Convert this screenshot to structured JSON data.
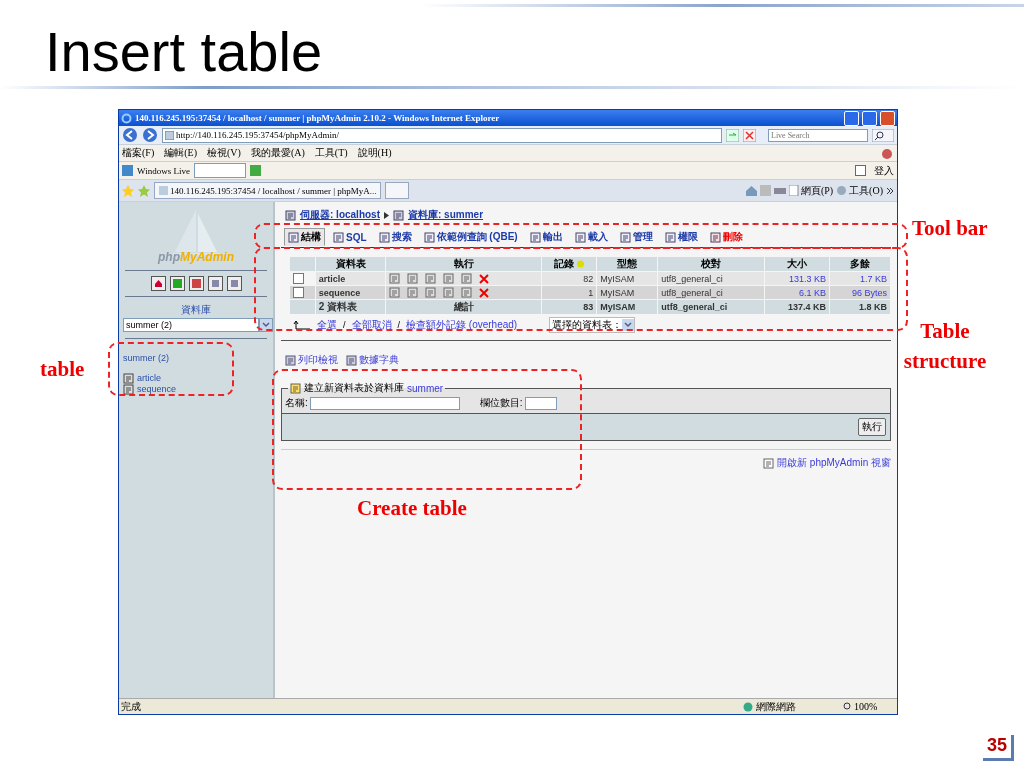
{
  "slide": {
    "title": "Insert table",
    "page_number": "35"
  },
  "browser": {
    "title": "140.116.245.195:37454 / localhost / summer | phpMyAdmin 2.10.2 - Windows Internet Explorer",
    "address": "http://140.116.245.195:37454/phpMyAdmin/",
    "search_placeholder": "Live Search",
    "menu": [
      "檔案(F)",
      "編輯(E)",
      "檢視(V)",
      "我的最愛(A)",
      "工具(T)",
      "說明(H)"
    ],
    "live_label": "Windows Live",
    "signin": "登入",
    "tab": "140.116.245.195:37454 / localhost / summer | phpMyA...",
    "command_bar": [
      "網頁(P)",
      "工具(O)"
    ],
    "status": "完成",
    "zone": "網際網路",
    "zoom": "100%"
  },
  "sidebar": {
    "logo_prefix": "php",
    "logo_suffix": "MyAdmin",
    "db_label": "資料庫",
    "db_select": "summer (2)",
    "db_heading": "summer (2)",
    "tables": [
      "article",
      "sequence"
    ]
  },
  "main": {
    "breadcrumb": [
      "伺服器: localhost",
      "資料庫: summer"
    ],
    "tabs": [
      {
        "label": "結構",
        "selected": true,
        "kind": "normal"
      },
      {
        "label": "SQL",
        "selected": false,
        "kind": "normal"
      },
      {
        "label": "搜索",
        "selected": false,
        "kind": "normal"
      },
      {
        "label": "依範例查詢 (QBE)",
        "selected": false,
        "kind": "normal"
      },
      {
        "label": "輸出",
        "selected": false,
        "kind": "normal"
      },
      {
        "label": "載入",
        "selected": false,
        "kind": "normal"
      },
      {
        "label": "管理",
        "selected": false,
        "kind": "normal"
      },
      {
        "label": "權限",
        "selected": false,
        "kind": "normal"
      },
      {
        "label": "刪除",
        "selected": false,
        "kind": "danger"
      }
    ],
    "columns": [
      "資料表",
      "執行",
      "記錄",
      "型態",
      "校對",
      "大小",
      "多餘"
    ],
    "rows": [
      {
        "name": "article",
        "records": "82",
        "type": "MyISAM",
        "collation": "utf8_general_ci",
        "size": "131.3 KB",
        "overhead": "1.7 KB",
        "checked": false
      },
      {
        "name": "sequence",
        "records": "1",
        "type": "MyISAM",
        "collation": "utf8_general_ci",
        "size": "6.1 KB",
        "overhead": "96 Bytes",
        "checked": false
      }
    ],
    "footer": {
      "name": "2 資料表",
      "label": "總計",
      "records": "83",
      "type": "MyISAM",
      "collation": "utf8_general_ci",
      "size": "137.4 KB",
      "overhead": "1.8 KB"
    },
    "check_links": [
      {
        "label": "全選",
        "kind": "link"
      },
      {
        "label": "/",
        "kind": "separator"
      },
      {
        "label": "全部取消",
        "kind": "link"
      },
      {
        "label": "/",
        "kind": "separator"
      },
      {
        "label": "檢查額外記錄 (overhead)",
        "kind": "link"
      }
    ],
    "with_selected": "選擇的資料表：",
    "links": [
      "列印檢視",
      "數據字典"
    ],
    "create": {
      "legend": "建立新資料表於資料庫",
      "database": "summer",
      "name_label": "名稱:",
      "fields_label": "欄位數目:",
      "go": "執行"
    },
    "open_window": "開啟新 phpMyAdmin 視窗"
  },
  "annotations": [
    "Tool bar",
    "Table structure",
    "table",
    "Create table"
  ]
}
